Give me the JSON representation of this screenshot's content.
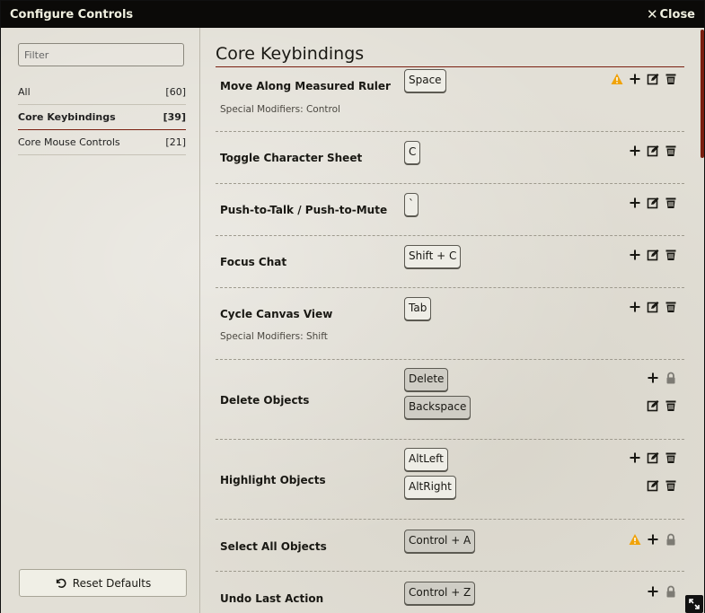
{
  "window": {
    "title": "Configure Controls",
    "close_label": "Close"
  },
  "filter": {
    "placeholder": "Filter"
  },
  "categories": [
    {
      "label": "All",
      "count": "[60]"
    },
    {
      "label": "Core Keybindings",
      "count": "[39]"
    },
    {
      "label": "Core Mouse Controls",
      "count": "[21]"
    }
  ],
  "reset_label": "Reset Defaults",
  "section_title": "Core Keybindings",
  "rows": [
    {
      "action": "Move Along Measured Ruler",
      "modifiers": "Special Modifiers: Control",
      "keys": [
        "Space"
      ],
      "warning": true,
      "locked": false
    },
    {
      "action": "Toggle Character Sheet",
      "modifiers": "",
      "keys": [
        "C"
      ],
      "warning": false,
      "locked": false
    },
    {
      "action": "Push-to-Talk / Push-to-Mute",
      "modifiers": "",
      "keys": [
        "`"
      ],
      "warning": false,
      "locked": false
    },
    {
      "action": "Focus Chat",
      "modifiers": "",
      "keys": [
        "Shift + C"
      ],
      "warning": false,
      "locked": false
    },
    {
      "action": "Cycle Canvas View",
      "modifiers": "Special Modifiers: Shift",
      "keys": [
        "Tab"
      ],
      "warning": false,
      "locked": false
    },
    {
      "action": "Delete Objects",
      "modifiers": "",
      "keys": [
        "Delete",
        "Backspace"
      ],
      "warning": false,
      "locked": true
    },
    {
      "action": "Highlight Objects",
      "modifiers": "",
      "keys": [
        "AltLeft",
        "AltRight"
      ],
      "warning": false,
      "locked": false
    },
    {
      "action": "Select All Objects",
      "modifiers": "",
      "keys": [
        "Control + A"
      ],
      "warning": true,
      "locked": true
    },
    {
      "action": "Undo Last Action",
      "modifiers": "",
      "keys": [
        "Control + Z"
      ],
      "warning": false,
      "locked": true
    }
  ],
  "colors": {
    "accent": "#7a1f10",
    "warning": "#f0a30a",
    "titlebar": "#0b0a08"
  },
  "icons": {
    "add": "plus-icon",
    "edit": "edit-icon",
    "delete": "trash-icon",
    "lock": "lock-icon",
    "warning": "warning-icon",
    "reset": "undo-icon",
    "close": "close-icon"
  }
}
